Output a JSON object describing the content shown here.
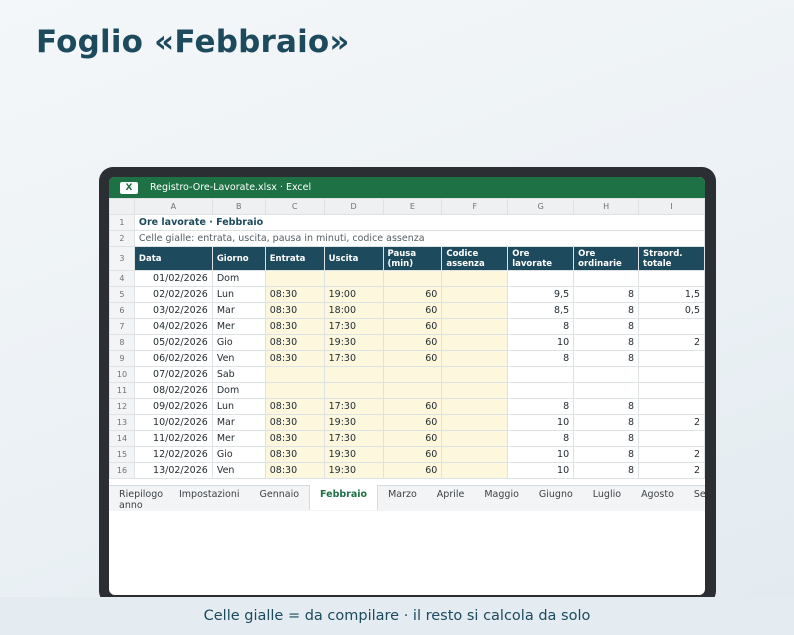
{
  "page_title": "Foglio «Febbraio»",
  "window": {
    "app_icon": "X",
    "title": "Registro-Ore-Lavorate.xlsx · Excel"
  },
  "columns": [
    "A",
    "B",
    "C",
    "D",
    "E",
    "F",
    "G",
    "H",
    "I"
  ],
  "sheet": {
    "title": "Ore lavorate · Febbraio",
    "subtitle": "Celle gialle: entrata, uscita, pausa in minuti, codice assenza",
    "headers": [
      "Data",
      "Giorno",
      "Entrata",
      "Uscita",
      "Pausa (min)",
      "Codice assenza",
      "Ore lavorate",
      "Ore ordinarie",
      "Straord. totale"
    ],
    "rows": [
      {
        "n": "4",
        "cells": [
          "01/02/2026",
          "Dom",
          "",
          "",
          "",
          "",
          "",
          "",
          ""
        ]
      },
      {
        "n": "5",
        "cells": [
          "02/02/2026",
          "Lun",
          "08:30",
          "19:00",
          "60",
          "",
          "9,5",
          "8",
          "1,5"
        ]
      },
      {
        "n": "6",
        "cells": [
          "03/02/2026",
          "Mar",
          "08:30",
          "18:00",
          "60",
          "",
          "8,5",
          "8",
          "0,5"
        ]
      },
      {
        "n": "7",
        "cells": [
          "04/02/2026",
          "Mer",
          "08:30",
          "17:30",
          "60",
          "",
          "8",
          "8",
          ""
        ]
      },
      {
        "n": "8",
        "cells": [
          "05/02/2026",
          "Gio",
          "08:30",
          "19:30",
          "60",
          "",
          "10",
          "8",
          "2"
        ]
      },
      {
        "n": "9",
        "cells": [
          "06/02/2026",
          "Ven",
          "08:30",
          "17:30",
          "60",
          "",
          "8",
          "8",
          ""
        ]
      },
      {
        "n": "10",
        "cells": [
          "07/02/2026",
          "Sab",
          "",
          "",
          "",
          "",
          "",
          "",
          ""
        ]
      },
      {
        "n": "11",
        "cells": [
          "08/02/2026",
          "Dom",
          "",
          "",
          "",
          "",
          "",
          "",
          ""
        ]
      },
      {
        "n": "12",
        "cells": [
          "09/02/2026",
          "Lun",
          "08:30",
          "17:30",
          "60",
          "",
          "8",
          "8",
          ""
        ]
      },
      {
        "n": "13",
        "cells": [
          "10/02/2026",
          "Mar",
          "08:30",
          "19:30",
          "60",
          "",
          "10",
          "8",
          "2"
        ]
      },
      {
        "n": "14",
        "cells": [
          "11/02/2026",
          "Mer",
          "08:30",
          "17:30",
          "60",
          "",
          "8",
          "8",
          ""
        ]
      },
      {
        "n": "15",
        "cells": [
          "12/02/2026",
          "Gio",
          "08:30",
          "19:30",
          "60",
          "",
          "10",
          "8",
          "2"
        ]
      },
      {
        "n": "16",
        "cells": [
          "13/02/2026",
          "Ven",
          "08:30",
          "19:30",
          "60",
          "",
          "10",
          "8",
          "2"
        ]
      }
    ]
  },
  "tabs": [
    "Riepilogo anno",
    "Impostazioni",
    "Gennaio",
    "Febbraio",
    "Marzo",
    "Aprile",
    "Maggio",
    "Giugno",
    "Luglio",
    "Agosto",
    "Settembre"
  ],
  "active_tab": "Febbraio",
  "footer": "Celle gialle = da compilare · il resto si calcola da solo",
  "colors": {
    "title": "#1d4a5c",
    "excel_green": "#1e7145",
    "header_fill": "#1d4a5c",
    "input_cell": "#fdf7de"
  }
}
